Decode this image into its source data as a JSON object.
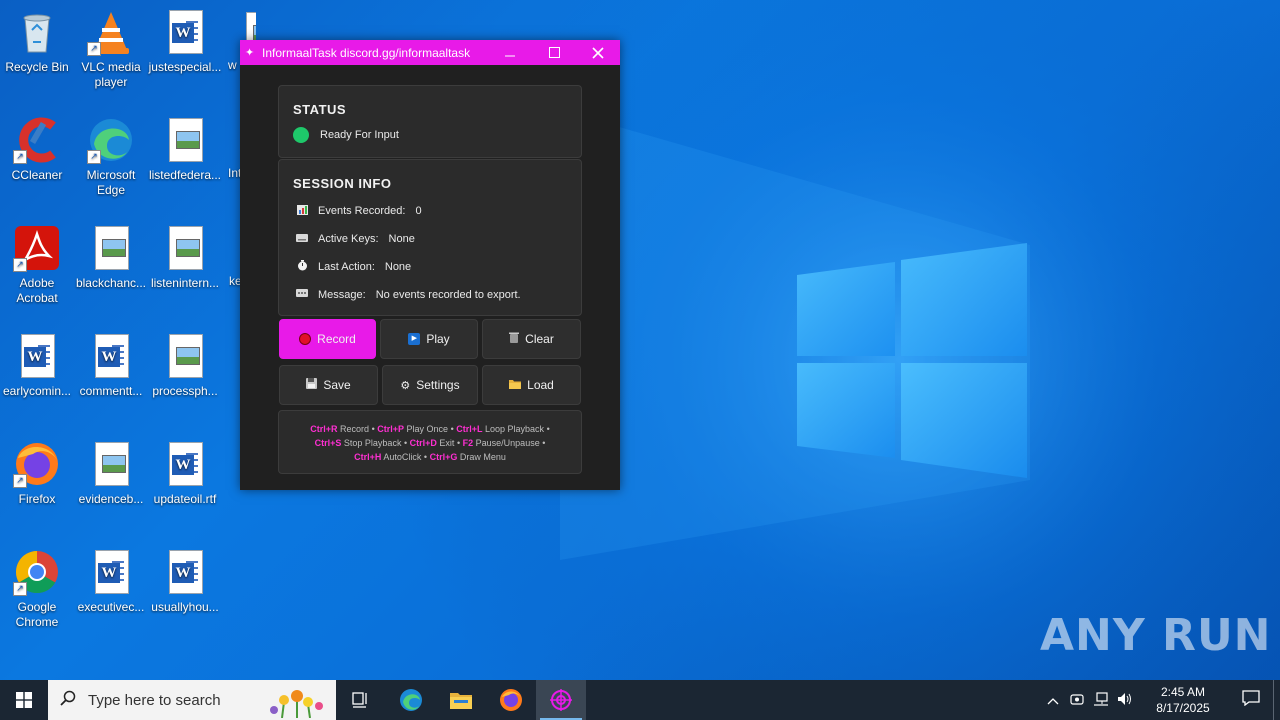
{
  "desktop": {
    "icons": [
      {
        "label": "Recycle Bin",
        "type": "recycle"
      },
      {
        "label": "VLC media player",
        "type": "vlc"
      },
      {
        "label": "justespecial...",
        "type": "word"
      },
      {
        "label": "CCleaner",
        "type": "ccleaner"
      },
      {
        "label": "Microsoft Edge",
        "type": "edge"
      },
      {
        "label": "listedfedera...",
        "type": "image"
      },
      {
        "label": "Adobe Acrobat",
        "type": "acrobat"
      },
      {
        "label": "blackchanc...",
        "type": "image"
      },
      {
        "label": "listenintern...",
        "type": "image"
      },
      {
        "label": "earlycomin...",
        "type": "word"
      },
      {
        "label": "commentt...",
        "type": "word"
      },
      {
        "label": "processph...",
        "type": "image"
      },
      {
        "label": "Firefox",
        "type": "firefox"
      },
      {
        "label": "evidenceb...",
        "type": "image"
      },
      {
        "label": "updateoil.rtf",
        "type": "word"
      },
      {
        "label": "Google Chrome",
        "type": "chrome"
      },
      {
        "label": "executivec...",
        "type": "word"
      },
      {
        "label": "usuallyhou...",
        "type": "word"
      }
    ],
    "partial_labels": [
      "w",
      "Int",
      "ke"
    ]
  },
  "app": {
    "title": "InformaalTask discord.gg/informaaltask",
    "title_icon": "sparkle-icon",
    "accent": "#e81ae8",
    "status": {
      "heading": "STATUS",
      "text": "Ready For Input",
      "dot_color": "#1ec86a"
    },
    "session": {
      "heading": "SESSION INFO",
      "events_label": "Events Recorded:",
      "events_value": "0",
      "keys_label": "Active Keys:",
      "keys_value": "None",
      "action_label": "Last Action:",
      "action_value": "None",
      "message_label": "Message:",
      "message_value": "No events recorded to export."
    },
    "buttons": {
      "record": "Record",
      "play": "Play",
      "clear": "Clear",
      "save": "Save",
      "settings": "Settings",
      "load": "Load"
    },
    "shortcuts": {
      "r_key": "Ctrl+R",
      "r_text": "Record",
      "p_key": "Ctrl+P",
      "p_text": "Play Once",
      "l_key": "Ctrl+L",
      "l_text": "Loop Playback",
      "s_key": "Ctrl+S",
      "s_text": "Stop Playback",
      "d_key": "Ctrl+D",
      "d_text": "Exit",
      "f2_key": "F2",
      "f2_text": "Pause/Unpause",
      "h_key": "Ctrl+H",
      "h_text": "AutoClick",
      "g_key": "Ctrl+G",
      "g_text": "Draw Menu",
      "separator": "•"
    }
  },
  "watermark": "ANY RUN",
  "taskbar": {
    "search_placeholder": "Type here to search",
    "pinned": [
      "task-view-icon",
      "edge-icon",
      "file-explorer-icon",
      "firefox-icon",
      "informaaltask-icon"
    ],
    "clock_time": "2:45 AM",
    "clock_date": "8/17/2025"
  }
}
